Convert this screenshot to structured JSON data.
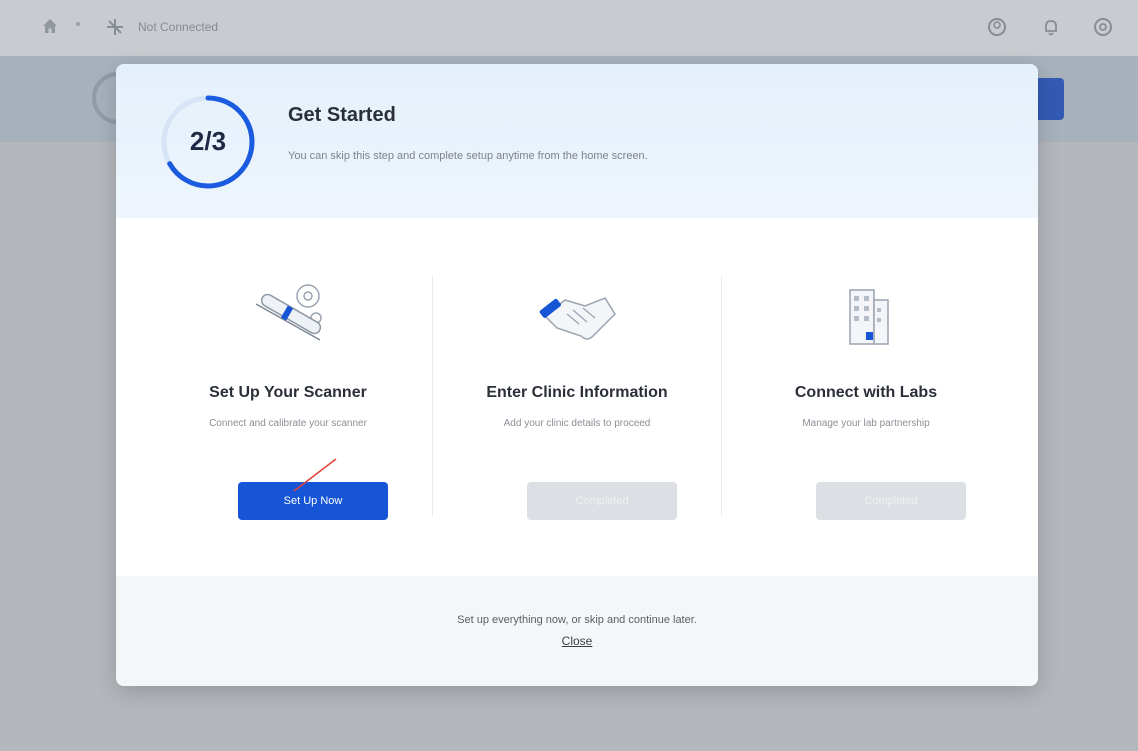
{
  "topbar": {
    "connection_status": "Not Connected",
    "icons": [
      "home-icon",
      "connection-icon",
      "account-icon",
      "bell-icon",
      "settings-icon"
    ]
  },
  "modal": {
    "progress_text": "2/3",
    "progress_fraction": 0.6667,
    "title": "Get Started",
    "subtitle": "You can skip this step and complete setup anytime from the home screen."
  },
  "steps": [
    {
      "title": "Set Up Your Scanner",
      "description": "Connect and calibrate your scanner",
      "button": "Set Up Now",
      "state": "active"
    },
    {
      "title": "Enter Clinic Information",
      "description": "Add your clinic details to proceed",
      "button": "Completed",
      "state": "disabled"
    },
    {
      "title": "Connect with Labs",
      "description": "Manage your lab partnership",
      "button": "Completed",
      "state": "disabled"
    }
  ],
  "footer": {
    "text": "Set up everything now, or skip and continue later.",
    "close": "Close"
  },
  "colors": {
    "accent": "#1555d6",
    "progress_ring": "#1a5be0",
    "header_bg": "#e4f0fb"
  }
}
